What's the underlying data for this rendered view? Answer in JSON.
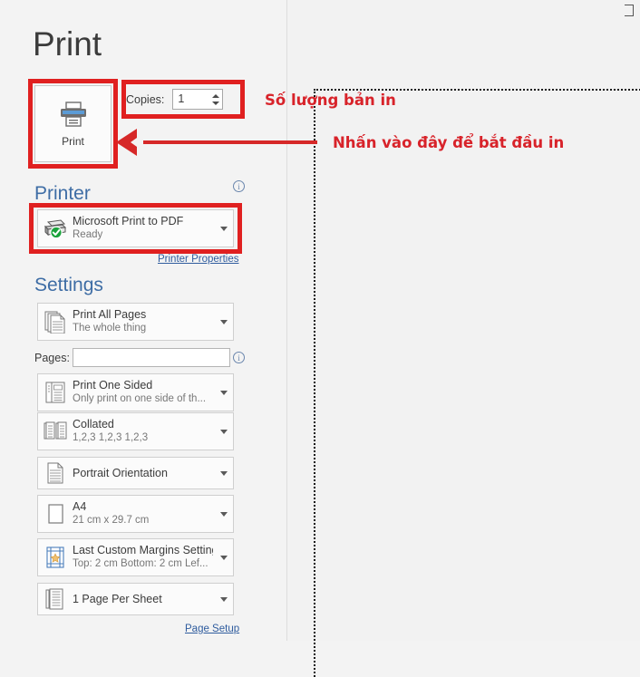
{
  "page": {
    "title": "Print"
  },
  "print_button": {
    "label": "Print",
    "icon": "printer-icon"
  },
  "copies": {
    "label": "Copies:",
    "value": "1",
    "spin_up_icon": "chevron-up-icon",
    "spin_down_icon": "chevron-down-icon"
  },
  "printer": {
    "heading": "Printer",
    "info_icon": "info-icon",
    "name": "Microsoft Print to PDF",
    "status": "Ready",
    "icon": "printer-ready-icon",
    "properties_link": "Printer Properties"
  },
  "settings": {
    "heading": "Settings",
    "pages_label": "Pages:",
    "pages_value": "",
    "pages_placeholder": "",
    "pages_info_icon": "info-icon",
    "page_setup_link": "Page Setup",
    "rows": [
      {
        "icon": "print-all-pages-icon",
        "title": "Print All Pages",
        "subtitle": "The whole thing"
      },
      {
        "icon": "print-one-sided-icon",
        "title": "Print One Sided",
        "subtitle": "Only print on one side of th..."
      },
      {
        "icon": "collated-icon",
        "title": "Collated",
        "subtitle": "1,2,3   1,2,3   1,2,3"
      },
      {
        "icon": "portrait-orientation-icon",
        "title": "Portrait Orientation",
        "subtitle": ""
      },
      {
        "icon": "paper-size-icon",
        "title": "A4",
        "subtitle": "21 cm x 29.7 cm"
      },
      {
        "icon": "margins-icon",
        "title": "Last Custom Margins Setting",
        "subtitle": "Top: 2 cm Bottom: 2 cm Lef..."
      },
      {
        "icon": "pages-per-sheet-icon",
        "title": "1 Page Per Sheet",
        "subtitle": ""
      }
    ]
  },
  "annotations": {
    "copies_note": "Số lượng bản in",
    "print_note": "Nhấn vào đây để bắt đầu in",
    "color": "#d8232a",
    "box_color": "#e02020"
  },
  "colors": {
    "background": "#f3f3f3",
    "heading_blue": "#3e6da5",
    "link_blue": "#2f5c9e",
    "text": "#3b3b3b",
    "subtext": "#777777",
    "status_green": "#1aa33c"
  }
}
